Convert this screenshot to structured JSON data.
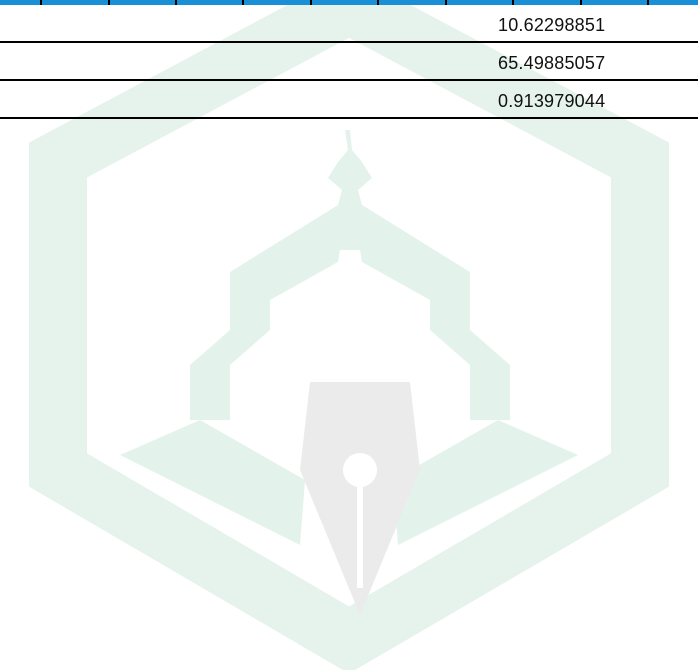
{
  "table": {
    "rows": [
      {
        "value": "10.62298851"
      },
      {
        "value": "65.49885057"
      },
      {
        "value": "0.913979044"
      }
    ]
  },
  "colors": {
    "header_fill": "#1b8fd6",
    "rule": "#000000",
    "watermark_green": "#e3f3ec",
    "watermark_gray": "#ececec"
  },
  "watermark": {
    "icon": "pen-nib-mosque-logo-icon"
  }
}
